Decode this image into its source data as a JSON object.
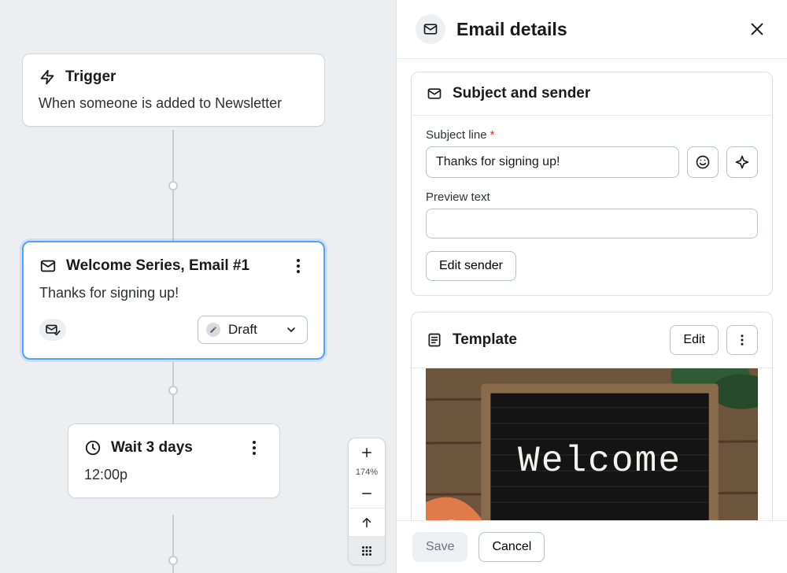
{
  "canvas": {
    "trigger": {
      "title": "Trigger",
      "description": "When someone is added to Newsletter"
    },
    "email": {
      "title": "Welcome Series, Email #1",
      "preview": "Thanks for signing up!",
      "status_label": "Draft"
    },
    "wait": {
      "title": "Wait 3 days",
      "time": "12:00p"
    }
  },
  "zoom": {
    "level": "174%"
  },
  "panel": {
    "title": "Email details",
    "subject_card": {
      "title": "Subject and sender",
      "subject_label": "Subject line",
      "subject_value": "Thanks for signing up!",
      "preview_label": "Preview text",
      "preview_value": "",
      "edit_sender": "Edit sender"
    },
    "template_card": {
      "title": "Template",
      "edit": "Edit",
      "img_text": "Welcome"
    },
    "footer": {
      "save": "Save",
      "cancel": "Cancel"
    }
  }
}
